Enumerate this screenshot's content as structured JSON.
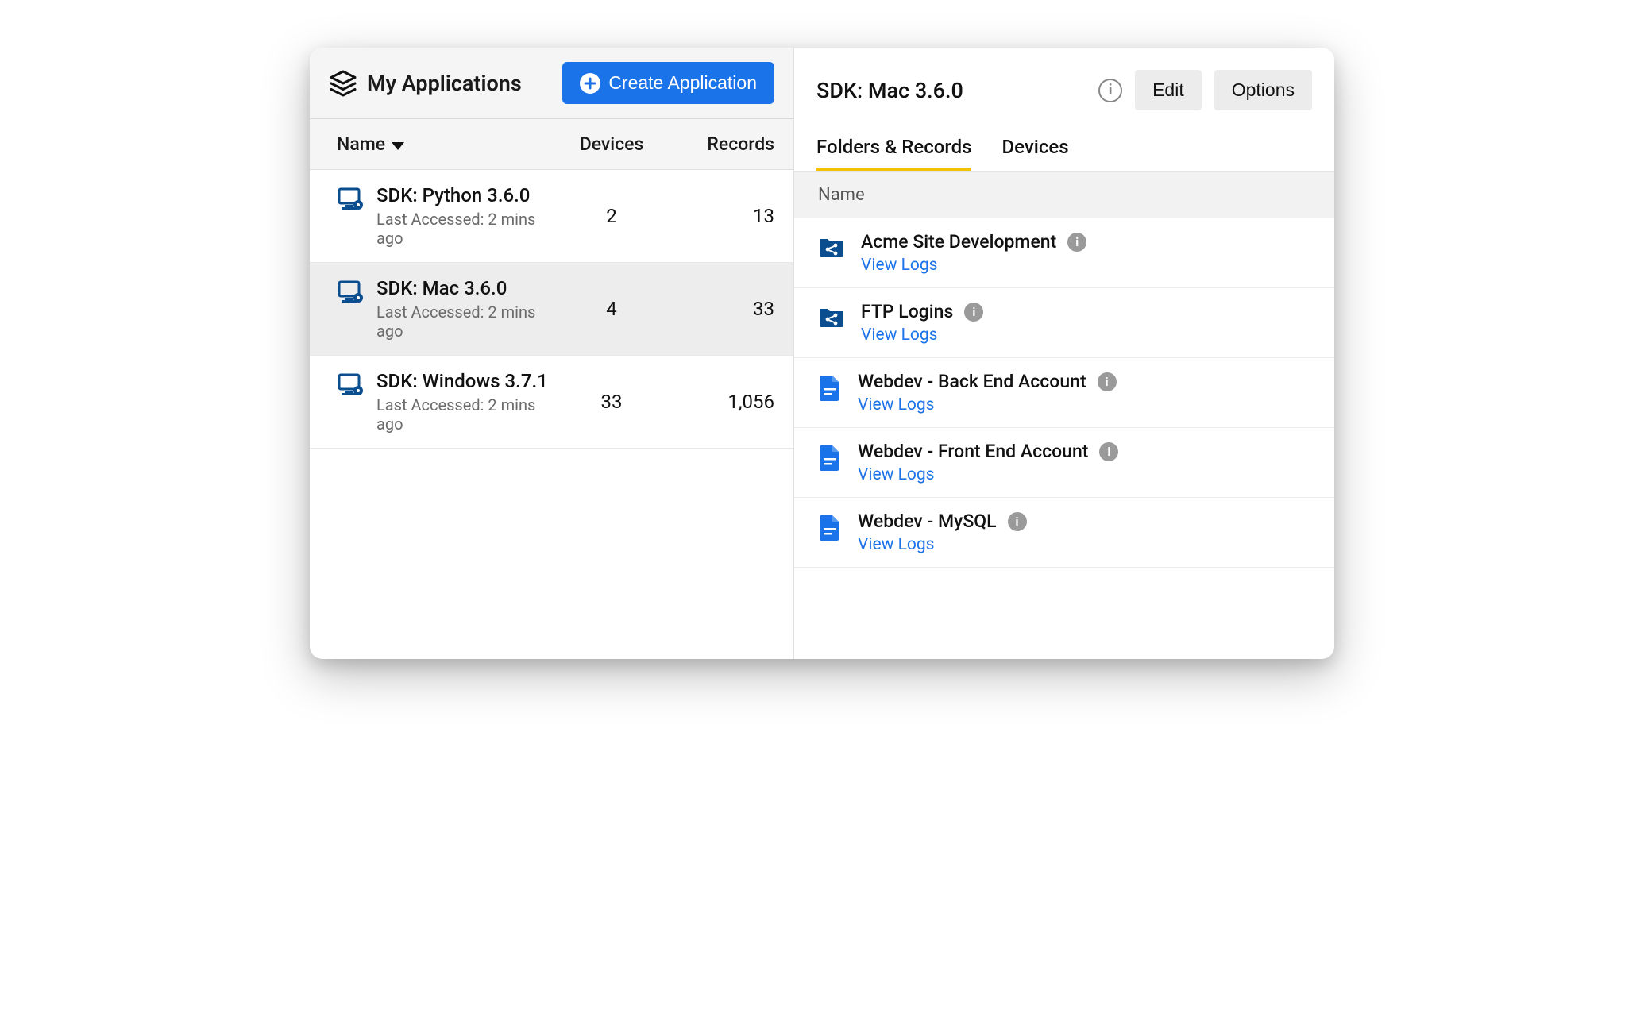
{
  "left": {
    "title": "My Applications",
    "create_button": "Create Application",
    "columns": {
      "name": "Name",
      "devices": "Devices",
      "records": "Records"
    },
    "apps": [
      {
        "title": "SDK: Python 3.6.0",
        "subtitle": "Last Accessed: 2 mins ago",
        "devices": "2",
        "records": "13",
        "selected": false
      },
      {
        "title": "SDK: Mac 3.6.0",
        "subtitle": "Last Accessed: 2 mins ago",
        "devices": "4",
        "records": "33",
        "selected": true
      },
      {
        "title": "SDK: Windows 3.7.1",
        "subtitle": "Last Accessed: 2 mins ago",
        "devices": "33",
        "records": "1,056",
        "selected": false
      }
    ]
  },
  "right": {
    "title": "SDK: Mac 3.6.0",
    "edit_button": "Edit",
    "options_button": "Options",
    "tabs": {
      "folders": "Folders & Records",
      "devices": "Devices"
    },
    "detail_name_header": "Name",
    "view_logs_label": "View Logs",
    "items": [
      {
        "icon": "share-folder",
        "title": "Acme Site Development"
      },
      {
        "icon": "share-folder",
        "title": "FTP Logins"
      },
      {
        "icon": "doc",
        "title": "Webdev - Back End Account"
      },
      {
        "icon": "doc",
        "title": "Webdev - Front End Account"
      },
      {
        "icon": "doc",
        "title": "Webdev - MySQL"
      }
    ]
  }
}
